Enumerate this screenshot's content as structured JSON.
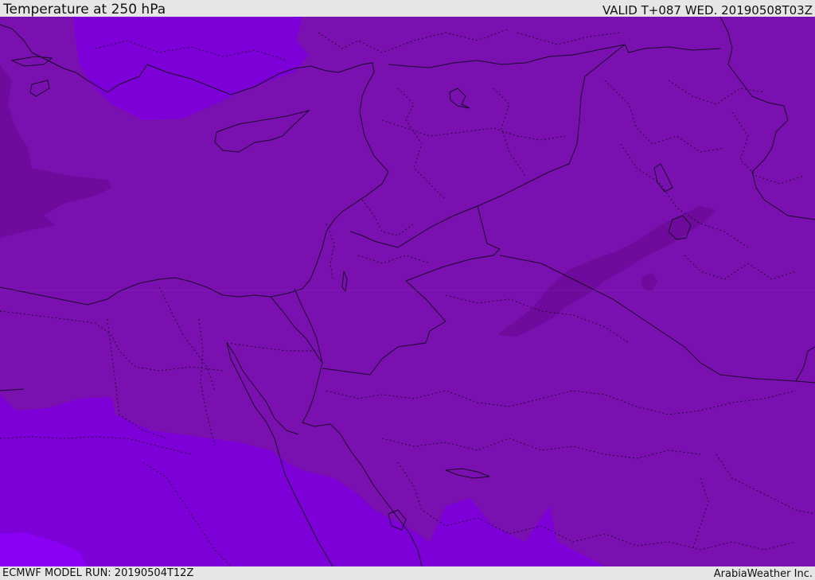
{
  "header": {
    "title": "Temperature at 250 hPa",
    "valid_time": "VALID T+087 WED. 20190508T03Z"
  },
  "footer": {
    "model_run": "ECMWF MODEL RUN: 20190504T12Z",
    "credit": "ArabiaWeather Inc."
  },
  "map": {
    "colors": {
      "base": "#7a10b0",
      "lighter": "#7d00d8",
      "lightest": "#8a00f5",
      "darker": "#6e0a9c",
      "darkest": "#640a90",
      "border": "#1a0a2a"
    }
  }
}
